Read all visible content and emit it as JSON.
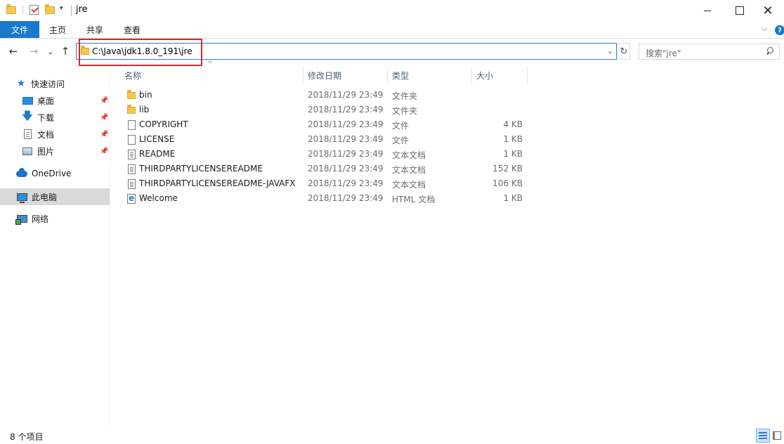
{
  "window": {
    "title": "jre",
    "minimize_icon": "minimize-icon",
    "maximize_icon": "maximize-icon",
    "close_glyph": "✕"
  },
  "ribbon": {
    "file_tab": "文件",
    "tabs": [
      "主页",
      "共享",
      "查看"
    ],
    "expand_glyph": "⌵",
    "help_glyph": "?"
  },
  "navigation": {
    "back_glyph": "←",
    "forward_glyph": "→",
    "recent_glyph": "⌄",
    "up_glyph": "↑",
    "address": "C:\\Java\\jdk1.8.0_191\\jre",
    "address_dropdown_glyph": "⌄",
    "refresh_glyph": "↻",
    "search_placeholder": "搜索\"jre\""
  },
  "sidebar": {
    "quick_access": "快速访问",
    "pinned": [
      {
        "label": "桌面",
        "icon": "desktop-icon"
      },
      {
        "label": "下载",
        "icon": "download-icon"
      },
      {
        "label": "文档",
        "icon": "documents-icon"
      },
      {
        "label": "图片",
        "icon": "pictures-icon"
      }
    ],
    "pin_glyph": "📌",
    "onedrive": "OneDrive",
    "this_pc": "此电脑",
    "network": "网络",
    "selected": "此电脑"
  },
  "columns": {
    "name": "名称",
    "date": "修改日期",
    "type": "类型",
    "size": "大小",
    "sort_glyph": "^"
  },
  "files": [
    {
      "name": "bin",
      "date": "2018/11/29 23:49",
      "type": "文件夹",
      "size": "",
      "icon": "folder-icon"
    },
    {
      "name": "lib",
      "date": "2018/11/29 23:49",
      "type": "文件夹",
      "size": "",
      "icon": "folder-icon"
    },
    {
      "name": "COPYRIGHT",
      "date": "2018/11/29 23:49",
      "type": "文件",
      "size": "4 KB",
      "icon": "file-icon"
    },
    {
      "name": "LICENSE",
      "date": "2018/11/29 23:49",
      "type": "文件",
      "size": "1 KB",
      "icon": "file-icon"
    },
    {
      "name": "README",
      "date": "2018/11/29 23:49",
      "type": "文本文档",
      "size": "1 KB",
      "icon": "text-file-icon"
    },
    {
      "name": "THIRDPARTYLICENSEREADME",
      "date": "2018/11/29 23:49",
      "type": "文本文档",
      "size": "152 KB",
      "icon": "text-file-icon"
    },
    {
      "name": "THIRDPARTYLICENSEREADME-JAVAFX",
      "date": "2018/11/29 23:49",
      "type": "文本文档",
      "size": "106 KB",
      "icon": "text-file-icon"
    },
    {
      "name": "Welcome",
      "date": "2018/11/29 23:49",
      "type": "HTML 文档",
      "size": "1 KB",
      "icon": "html-file-icon"
    }
  ],
  "status": {
    "item_count": "8 个项目"
  },
  "colors": {
    "accent": "#1979ca",
    "highlight_box": "#d22b2b",
    "selection": "#d9d9d9"
  }
}
